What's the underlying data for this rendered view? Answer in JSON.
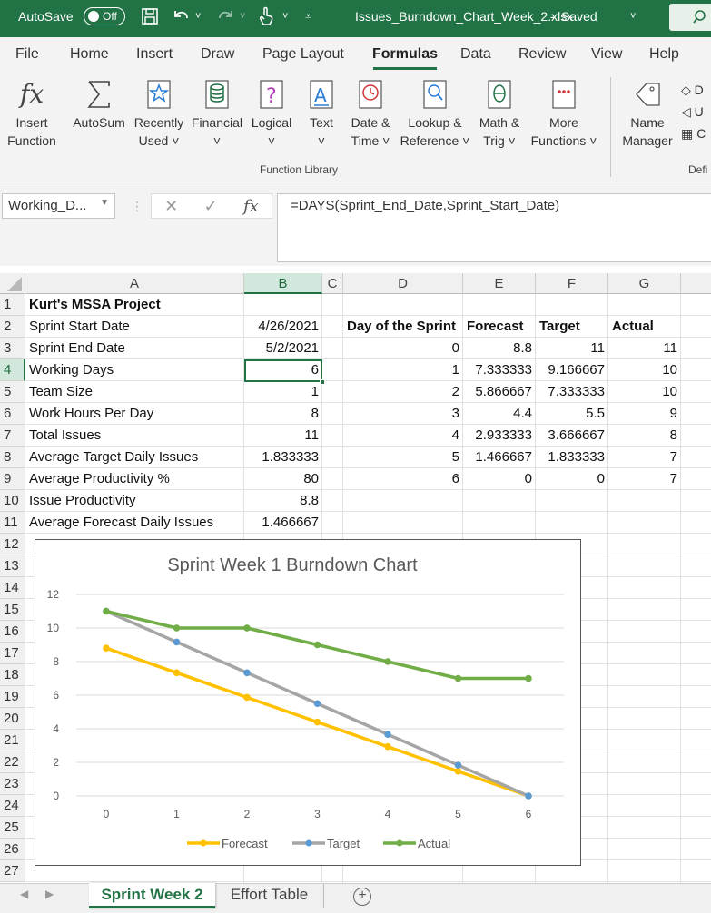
{
  "titlebar": {
    "autosave_label": "AutoSave",
    "autosave_state": "Off",
    "document_title": "Issues_Burndown_Chart_Week_2.xlsx",
    "save_status": "Saved"
  },
  "ribbon": {
    "tabs": [
      "File",
      "Home",
      "Insert",
      "Draw",
      "Page Layout",
      "Formulas",
      "Data",
      "Review",
      "View",
      "Help"
    ],
    "active_tab": "Formulas",
    "buttons": [
      {
        "line1": "Insert",
        "line2": "Function",
        "icon": "fx-icon"
      },
      {
        "line1": "AutoSum",
        "line2": "",
        "icon": "sigma-icon"
      },
      {
        "line1": "Recently",
        "line2": "Used ˅",
        "icon": "star-book-icon"
      },
      {
        "line1": "Financial",
        "line2": "˅",
        "icon": "coins-book-icon"
      },
      {
        "line1": "Logical",
        "line2": "˅",
        "icon": "question-book-icon"
      },
      {
        "line1": "Text",
        "line2": "˅",
        "icon": "text-book-icon"
      },
      {
        "line1": "Date &",
        "line2": "Time ˅",
        "icon": "clock-book-icon"
      },
      {
        "line1": "Lookup &",
        "line2": "Reference ˅",
        "icon": "magnifier-book-icon"
      },
      {
        "line1": "Math &",
        "line2": "Trig ˅",
        "icon": "theta-book-icon"
      },
      {
        "line1": "More",
        "line2": "Functions ˅",
        "icon": "more-book-icon"
      },
      {
        "line1": "Name",
        "line2": "Manager",
        "icon": "name-tag-icon"
      }
    ],
    "group_label": "Function Library",
    "def_group_label": "Defi",
    "def_items": [
      "D",
      "U",
      "C"
    ]
  },
  "formula_bar": {
    "name_box": "Working_D...",
    "formula": "=DAYS(Sprint_End_Date,Sprint_Start_Date)"
  },
  "sheet": {
    "columns": [
      "A",
      "B",
      "C",
      "D",
      "E",
      "F",
      "G"
    ],
    "selected_column": "B",
    "selected_row": "4",
    "rows": [
      "1",
      "2",
      "3",
      "4",
      "5",
      "6",
      "7",
      "8",
      "9",
      "10",
      "11",
      "12",
      "13",
      "14",
      "15",
      "16",
      "17",
      "18",
      "19",
      "20",
      "21",
      "22",
      "23",
      "24",
      "25",
      "26",
      "27"
    ],
    "a_col": [
      "Kurt's MSSA Project",
      "Sprint Start Date",
      "Sprint End Date",
      "Working Days",
      "Team Size",
      "Work Hours Per Day",
      "Total Issues",
      "Average Target Daily Issues",
      "Average Productivity %",
      "Issue Productivity",
      "Average Forecast Daily Issues"
    ],
    "b_col": [
      "",
      "4/26/2021",
      "5/2/2021",
      "6",
      "1",
      "8",
      "11",
      "1.833333",
      "80",
      "8.8",
      "1.466667"
    ],
    "table_headers": [
      "Day of the Sprint",
      "Forecast",
      "Target",
      "Actual"
    ],
    "table_rows": [
      [
        "0",
        "8.8",
        "11",
        "11"
      ],
      [
        "1",
        "7.333333",
        "9.166667",
        "10"
      ],
      [
        "2",
        "5.866667",
        "7.333333",
        "10"
      ],
      [
        "3",
        "4.4",
        "5.5",
        "9"
      ],
      [
        "4",
        "2.933333",
        "3.666667",
        "8"
      ],
      [
        "5",
        "1.466667",
        "1.833333",
        "7"
      ],
      [
        "6",
        "0",
        "0",
        "7"
      ]
    ]
  },
  "chart_data": {
    "type": "line",
    "title": "Sprint Week 1 Burndown Chart",
    "x": [
      0,
      1,
      2,
      3,
      4,
      5,
      6
    ],
    "series": [
      {
        "name": "Forecast",
        "values": [
          8.8,
          7.333333,
          5.866667,
          4.4,
          2.933333,
          1.466667,
          0
        ],
        "color": "#FFC000"
      },
      {
        "name": "Target",
        "values": [
          11,
          9.166667,
          7.333333,
          5.5,
          3.666667,
          1.833333,
          0
        ],
        "color": "#A5A5A5"
      },
      {
        "name": "Actual",
        "values": [
          11,
          10,
          10,
          9,
          8,
          7,
          7
        ],
        "color": "#70AD47"
      }
    ],
    "ylim": [
      0,
      12
    ],
    "yticks": [
      0,
      2,
      4,
      6,
      8,
      10,
      12
    ],
    "grid": true,
    "legend": "bottom"
  },
  "sheet_tabs": {
    "tabs": [
      "Sprint Week 2",
      "Effort Table"
    ],
    "active": "Sprint Week 2",
    "add_symbol": "+"
  },
  "colors": {
    "excel_green": "#217346"
  }
}
